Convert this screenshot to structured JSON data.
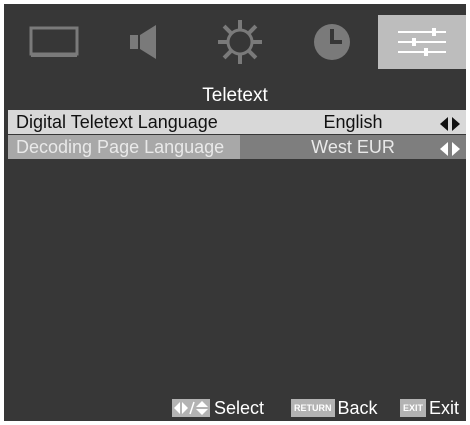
{
  "tabs": [
    {
      "name": "picture",
      "icon": "monitor-icon"
    },
    {
      "name": "sound",
      "icon": "speaker-icon"
    },
    {
      "name": "settings",
      "icon": "gear-icon"
    },
    {
      "name": "time",
      "icon": "clock-icon"
    },
    {
      "name": "options",
      "icon": "sliders-icon",
      "active": true
    }
  ],
  "menu": {
    "title": "Teletext",
    "rows": [
      {
        "label": "Digital Teletext Language",
        "value": "English"
      },
      {
        "label": "Decoding Page Language",
        "value": "West EUR"
      }
    ]
  },
  "footer": {
    "select_label": "Select",
    "return_key": "RETURN",
    "back_label": "Back",
    "exit_key": "EXIT",
    "exit_label": "Exit"
  },
  "colors": {
    "background": "#373737",
    "active_tab": "#bdbdbd",
    "row_highlight": "#d8d8d8",
    "row_selected": "#7e7e7e"
  }
}
